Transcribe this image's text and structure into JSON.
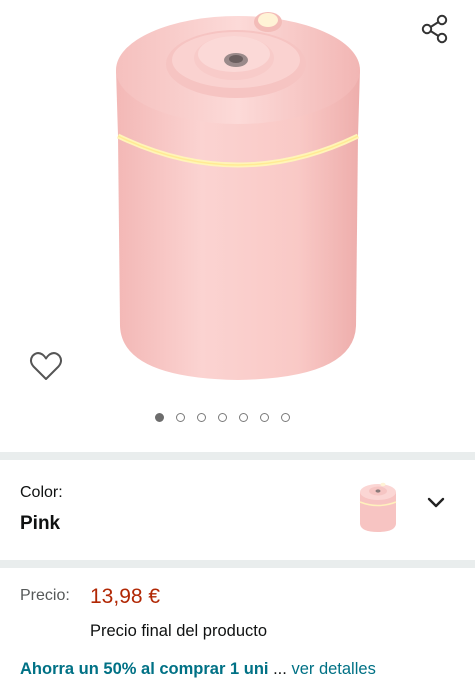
{
  "gallery": {
    "image_count": 7,
    "active_index": 0
  },
  "icons": {
    "share": "share-icon",
    "wishlist": "heart-outline-icon",
    "variant_dropdown": "chevron-down-icon"
  },
  "variant": {
    "label": "Color:",
    "value": "Pink"
  },
  "price": {
    "label": "Precio:",
    "value": "13,98 €",
    "note": "Precio final del producto"
  },
  "promo": {
    "text": "Ahorra un 50% al comprar 1 uni",
    "ellipsis": "...",
    "link": "ver detalles"
  },
  "colors": {
    "price": "#B12704",
    "link": "#007185",
    "product_pink": "#F7CACA",
    "light_band": "#FFF3C0"
  }
}
